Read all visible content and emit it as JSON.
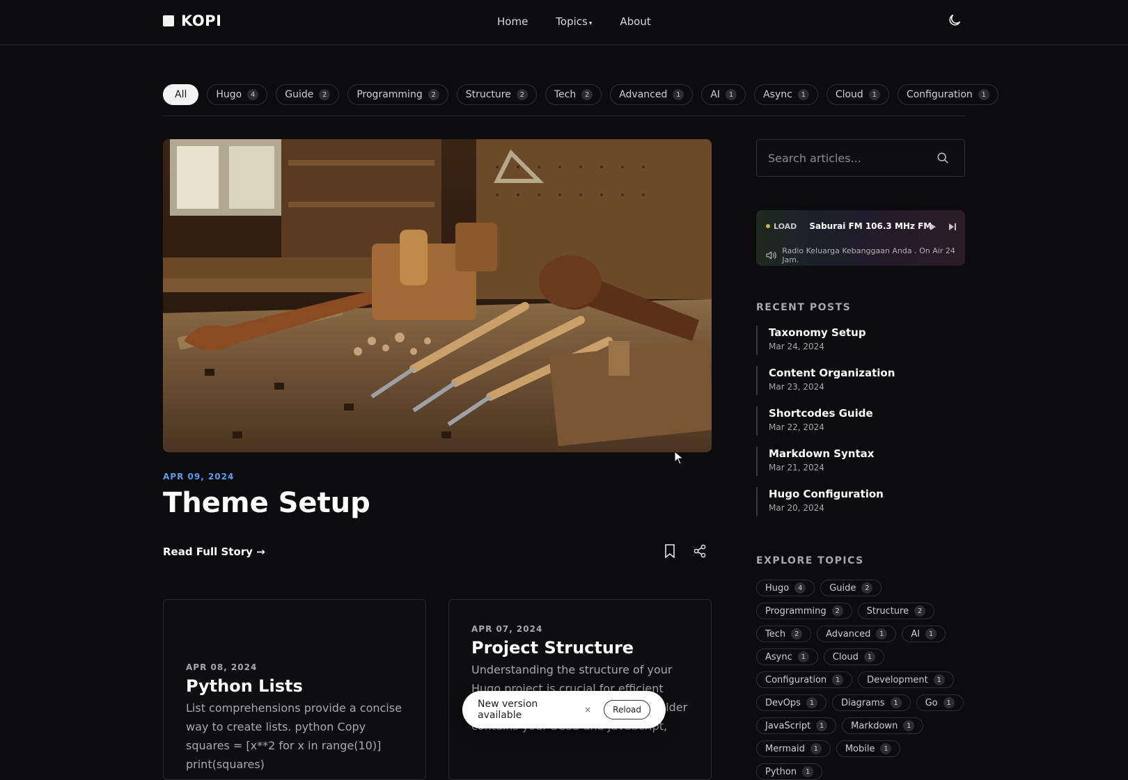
{
  "header": {
    "brand": "KOPI",
    "nav": [
      {
        "label": "Home"
      },
      {
        "label": "Topics",
        "caret": "▾"
      },
      {
        "label": "About"
      }
    ],
    "theme_toggle_icon": "moon-icon"
  },
  "filters": [
    {
      "label": "All",
      "count": null,
      "active": true
    },
    {
      "label": "Hugo",
      "count": "4"
    },
    {
      "label": "Guide",
      "count": "2"
    },
    {
      "label": "Programming",
      "count": "2"
    },
    {
      "label": "Structure",
      "count": "2"
    },
    {
      "label": "Tech",
      "count": "2"
    },
    {
      "label": "Advanced",
      "count": "1"
    },
    {
      "label": "AI",
      "count": "1"
    },
    {
      "label": "Async",
      "count": "1"
    },
    {
      "label": "Cloud",
      "count": "1"
    },
    {
      "label": "Configuration",
      "count": "1"
    }
  ],
  "hero": {
    "date": "APR 09, 2024",
    "title": "Theme Setup",
    "read_more": "Read Full Story →"
  },
  "cards": [
    {
      "date": "APR 08, 2024",
      "title": "Python Lists",
      "excerpt": "List comprehensions provide a concise way to create lists. python Copy squares = [x**2 for x in range(10)] print(squares)"
    },
    {
      "date": "APR 07, 2024",
      "title": "Project Structure",
      "excerpt": "Understanding the structure of your Hugo project is crucial for efficient development. Assets The assets folder contains your SCSS and JavaScript,"
    }
  ],
  "toast": {
    "message": "New version available",
    "close": "×",
    "reload": "Reload"
  },
  "sidebar": {
    "search_placeholder": "Search articles...",
    "radio": {
      "status": "LOAD",
      "station": "Saburai FM 106.3 MHz FM",
      "tagline": "Radio Keluarga Kebanggaan Anda . On Air 24 Jam."
    },
    "recent_heading": "RECENT POSTS",
    "recent_posts": [
      {
        "title": "Taxonomy Setup",
        "date": "Mar 24, 2024"
      },
      {
        "title": "Content Organization",
        "date": "Mar 23, 2024"
      },
      {
        "title": "Shortcodes Guide",
        "date": "Mar 22, 2024"
      },
      {
        "title": "Markdown Syntax",
        "date": "Mar 21, 2024"
      },
      {
        "title": "Hugo Configuration",
        "date": "Mar 20, 2024"
      }
    ],
    "topics_heading": "EXPLORE TOPICS",
    "topics": [
      {
        "label": "Hugo",
        "count": "4"
      },
      {
        "label": "Guide",
        "count": "2"
      },
      {
        "label": "Programming",
        "count": "2"
      },
      {
        "label": "Structure",
        "count": "2"
      },
      {
        "label": "Tech",
        "count": "2"
      },
      {
        "label": "Advanced",
        "count": "1"
      },
      {
        "label": "AI",
        "count": "1"
      },
      {
        "label": "Async",
        "count": "1"
      },
      {
        "label": "Cloud",
        "count": "1"
      },
      {
        "label": "Configuration",
        "count": "1"
      },
      {
        "label": "Development",
        "count": "1"
      },
      {
        "label": "DevOps",
        "count": "1"
      },
      {
        "label": "Diagrams",
        "count": "1"
      },
      {
        "label": "Go",
        "count": "1"
      },
      {
        "label": "JavaScript",
        "count": "1"
      },
      {
        "label": "Markdown",
        "count": "1"
      },
      {
        "label": "Mermaid",
        "count": "1"
      },
      {
        "label": "Mobile",
        "count": "1"
      },
      {
        "label": "Python",
        "count": "1"
      }
    ]
  },
  "colors": {
    "background": "#0c0c0e",
    "accent_date": "#5b9cf0",
    "text": "#e8e8ea"
  }
}
